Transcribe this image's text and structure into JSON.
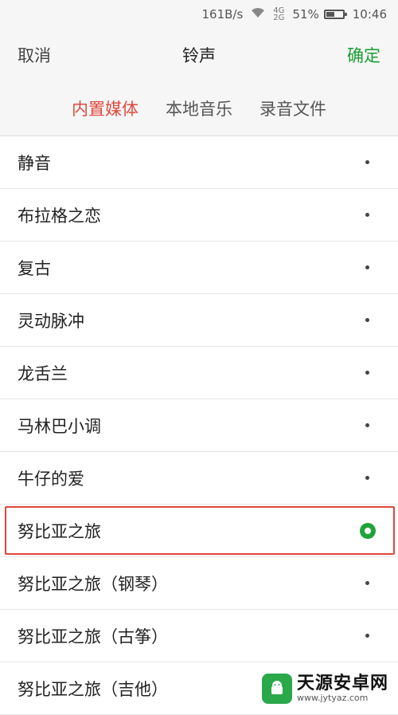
{
  "status_bar": {
    "speed": "161B/s",
    "network_top": "4G",
    "network_bottom": "2G",
    "battery_percent": "51%",
    "battery_level": 0.51,
    "time": "10:46"
  },
  "header": {
    "cancel_label": "取消",
    "title": "铃声",
    "confirm_label": "确定",
    "confirm_color": "#1a9c34"
  },
  "tabs": [
    {
      "label": "内置媒体",
      "active": true
    },
    {
      "label": "本地音乐",
      "active": false
    },
    {
      "label": "录音文件",
      "active": false
    }
  ],
  "ringtones": [
    {
      "label": "静音",
      "selected": false
    },
    {
      "label": "布拉格之恋",
      "selected": false
    },
    {
      "label": "复古",
      "selected": false
    },
    {
      "label": "灵动脉冲",
      "selected": false
    },
    {
      "label": "龙舌兰",
      "selected": false
    },
    {
      "label": "马林巴小调",
      "selected": false
    },
    {
      "label": "牛仔的爱",
      "selected": false
    },
    {
      "label": "努比亚之旅",
      "selected": true
    },
    {
      "label": "努比亚之旅（钢琴）",
      "selected": false
    },
    {
      "label": "努比亚之旅（古筝）",
      "selected": false
    },
    {
      "label": "努比亚之旅（吉他）",
      "selected": false
    }
  ],
  "watermark": {
    "name": "天源安卓网",
    "url": "www.jytyaz.com"
  }
}
